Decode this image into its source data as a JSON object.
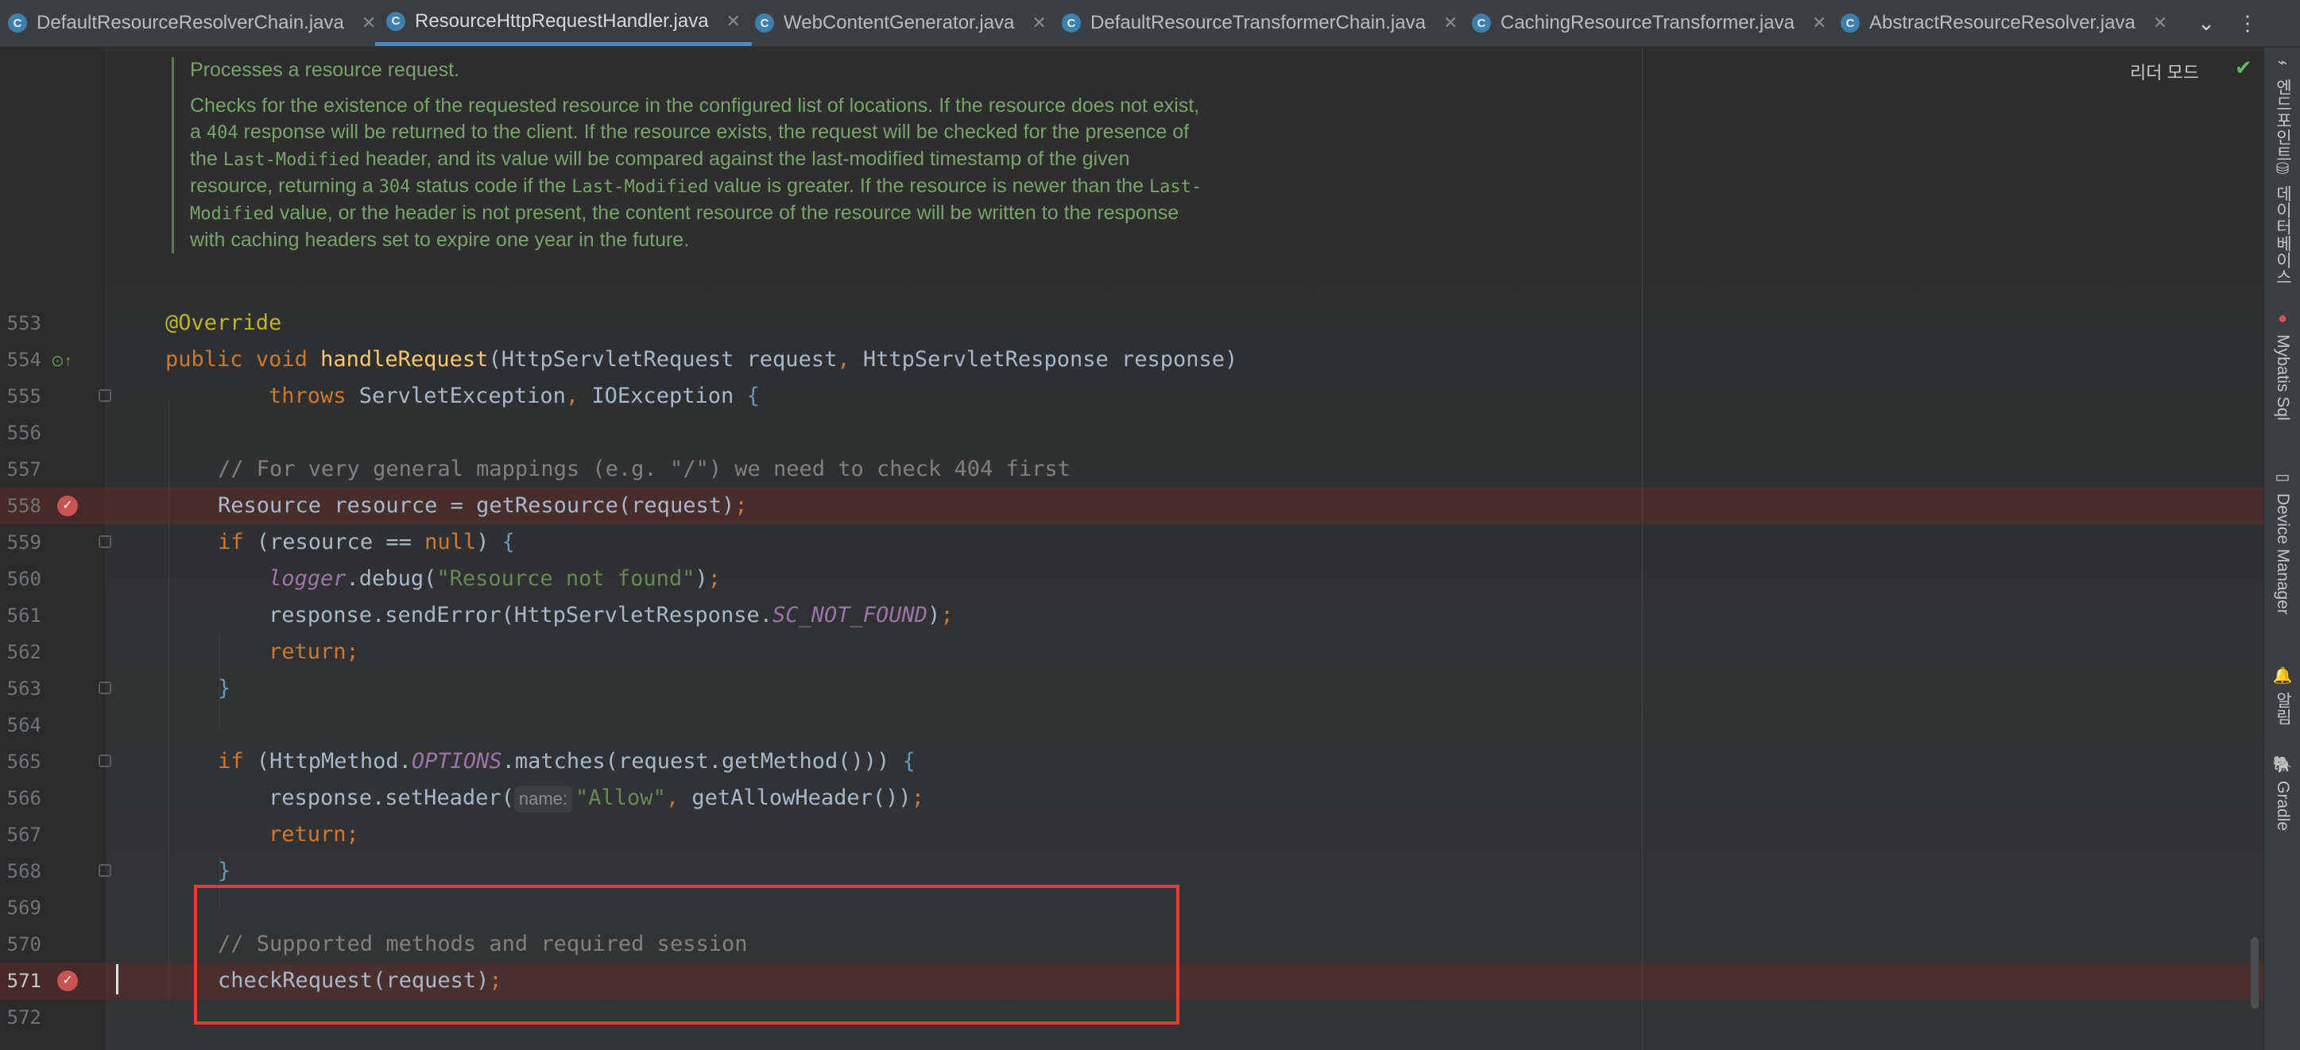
{
  "tabs": [
    {
      "label": "DefaultResourceResolverChain.java",
      "icon": "class-icon",
      "active": false
    },
    {
      "label": "ResourceHttpRequestHandler.java",
      "icon": "class-icon",
      "active": true
    },
    {
      "label": "WebContentGenerator.java",
      "icon": "abstract-class-icon",
      "active": false
    },
    {
      "label": "DefaultResourceTransformerChain.java",
      "icon": "class-icon",
      "active": false
    },
    {
      "label": "CachingResourceTransformer.java",
      "icon": "class-icon",
      "active": false
    },
    {
      "label": "AbstractResourceResolver.java",
      "icon": "abstract-class-icon",
      "active": false
    }
  ],
  "tab_tools": {
    "more_tabs": "⌄",
    "menu": "⋮"
  },
  "reader_mode": "리더 모드",
  "javadoc": {
    "summary": "Processes a resource request.",
    "p1": "Checks for the existence of the requested resource in the configured list of locations. If the resource does not exist, a ",
    "c1": "404",
    "p2": " response will be returned to the client. If the resource exists, the request will be checked for the presence of the ",
    "c2": "Last-Modified",
    "p3": " header, and its value will be compared against the last-modified timestamp of the given resource, returning a ",
    "c3": "304",
    "p4": " status code if the ",
    "c4": "Last-Modified",
    "p5": " value is greater. If the resource is newer than the ",
    "c5": "Last-Modified",
    "p6": " value, or the header is not present, the content resource of the resource will be written to the response with caching headers set to expire one year in the future."
  },
  "code": {
    "l553": {
      "num": "553",
      "ann": "@Override"
    },
    "l554": {
      "num": "554",
      "kw1": "public",
      "kw2": "void",
      "fn": "handleRequest",
      "p1": "(HttpServletRequest request",
      "comma": ",",
      "p2": " HttpServletResponse response)"
    },
    "l555": {
      "num": "555",
      "kw": "throws",
      "t1": " ServletException",
      "comma": ",",
      "t2": " IOException ",
      "brace": "{"
    },
    "l556": {
      "num": "556"
    },
    "l557": {
      "num": "557",
      "comment": "// For very general mappings (e.g. \"/\") we need to check 404 first"
    },
    "l558": {
      "num": "558",
      "text": "Resource resource = getResource(request)",
      "semi": ";"
    },
    "l559": {
      "num": "559",
      "kw": "if",
      "t1": " (resource == ",
      "kw2": "null",
      "t2": ") ",
      "brace": "{"
    },
    "l560": {
      "num": "560",
      "it": "logger",
      "t1": ".debug(",
      "str": "\"Resource not found\"",
      "t2": ")",
      "semi": ";"
    },
    "l561": {
      "num": "561",
      "t1": "response.sendError(HttpServletResponse.",
      "it": "SC_NOT_FOUND",
      "t2": ")",
      "semi": ";"
    },
    "l562": {
      "num": "562",
      "kw": "return",
      "semi": ";"
    },
    "l563": {
      "num": "563",
      "brace": "}"
    },
    "l564": {
      "num": "564"
    },
    "l565": {
      "num": "565",
      "kw": "if",
      "t1": " (HttpMethod.",
      "it": "OPTIONS",
      "t2": ".matches(request.getMethod())) ",
      "brace": "{"
    },
    "l566": {
      "num": "566",
      "t1": "response.setHeader(",
      "hint": "name:",
      "str": "\"Allow\"",
      "comma": ",",
      "t2": " getAllowHeader())",
      "semi": ";"
    },
    "l567": {
      "num": "567",
      "kw": "return",
      "semi": ";"
    },
    "l568": {
      "num": "568",
      "brace": "}"
    },
    "l569": {
      "num": "569"
    },
    "l570": {
      "num": "570",
      "comment": "// Supported methods and required session"
    },
    "l571": {
      "num": "571",
      "text": "checkRequest(request)",
      "semi": ";"
    },
    "l572": {
      "num": "572"
    }
  },
  "right_tools": [
    {
      "label": "엔드포인트",
      "icon": "endpoint-icon"
    },
    {
      "label": "데이터베이스",
      "icon": "database-icon"
    },
    {
      "label": "Mybatis Sql",
      "icon": "mybatis-icon"
    },
    {
      "label": "Device Manager",
      "icon": "device-manager-icon"
    },
    {
      "label": "알림",
      "icon": "bell-icon"
    },
    {
      "label": "Gradle",
      "icon": "gradle-icon"
    }
  ],
  "colors": {
    "keyword": "#cc7832",
    "method": "#ffc66d",
    "comment": "#808080",
    "string": "#6a8759",
    "constant": "#9876aa",
    "breakpoint": "#c75450",
    "highlight": "#e0402c"
  }
}
